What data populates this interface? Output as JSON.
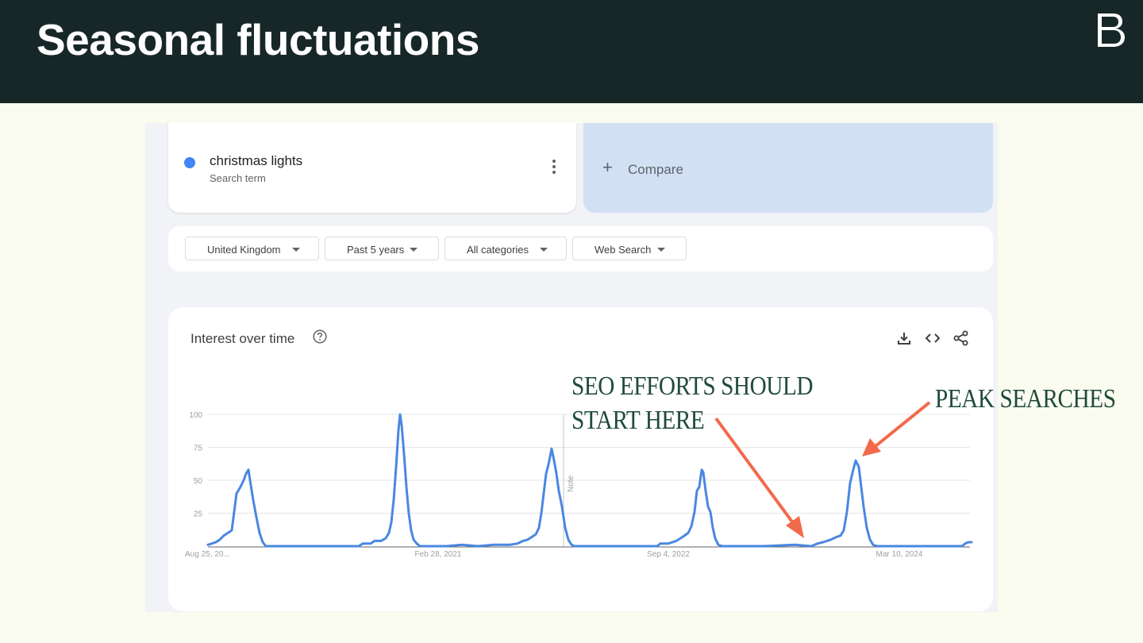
{
  "slide": {
    "title": "Seasonal fluctuations",
    "logo": "B"
  },
  "search_term": {
    "name": "christmas lights",
    "type": "Search term",
    "color": "#4285f4"
  },
  "compare": {
    "label": "Compare",
    "icon": "plus-icon"
  },
  "filters": [
    {
      "label": "United Kingdom"
    },
    {
      "label": "Past 5 years"
    },
    {
      "label": "All categories"
    },
    {
      "label": "Web Search"
    }
  ],
  "chart_card": {
    "title": "Interest over time",
    "icons": [
      "help-icon",
      "download-icon",
      "embed-icon",
      "share-icon"
    ]
  },
  "annotations": {
    "seo_line1": "SEO EFFORTS SHOULD",
    "seo_line2": "START HERE",
    "peak": "PEAK SEARCHES",
    "arrow_color": "#f26a4b"
  },
  "chart_data": {
    "type": "line",
    "title": "",
    "ylim": [
      0,
      100
    ],
    "y_ticks": [
      "25",
      "50",
      "75",
      "100"
    ],
    "x_tick_labels": [
      "Aug 25, 20...",
      "Feb 28, 2021",
      "Sep 4, 2022",
      "Mar 10, 2024"
    ],
    "note_label": "Note",
    "grid": true,
    "series": [
      {
        "name": "christmas lights",
        "color": "#4a87e0",
        "points": [
          [
            0,
            1
          ],
          [
            5,
            2
          ],
          [
            10,
            3
          ],
          [
            15,
            5
          ],
          [
            20,
            8
          ],
          [
            25,
            10
          ],
          [
            30,
            12
          ],
          [
            36,
            40
          ],
          [
            41,
            45
          ],
          [
            45,
            50
          ],
          [
            48,
            55
          ],
          [
            51,
            58
          ],
          [
            53,
            50
          ],
          [
            57,
            35
          ],
          [
            61,
            22
          ],
          [
            65,
            10
          ],
          [
            69,
            3
          ],
          [
            73,
            0
          ],
          [
            120,
            0
          ],
          [
            170,
            0
          ],
          [
            190,
            0
          ],
          [
            195,
            2
          ],
          [
            205,
            2
          ],
          [
            210,
            4
          ],
          [
            218,
            4
          ],
          [
            224,
            6
          ],
          [
            228,
            10
          ],
          [
            231,
            18
          ],
          [
            234,
            35
          ],
          [
            237,
            60
          ],
          [
            240,
            88
          ],
          [
            242,
            100
          ],
          [
            244,
            92
          ],
          [
            247,
            70
          ],
          [
            250,
            45
          ],
          [
            253,
            25
          ],
          [
            256,
            12
          ],
          [
            259,
            5
          ],
          [
            263,
            2
          ],
          [
            267,
            0
          ],
          [
            300,
            0
          ],
          [
            320,
            1
          ],
          [
            340,
            0
          ],
          [
            360,
            1
          ],
          [
            380,
            1
          ],
          [
            390,
            2
          ],
          [
            397,
            4
          ],
          [
            403,
            5
          ],
          [
            408,
            7
          ],
          [
            413,
            9
          ],
          [
            417,
            14
          ],
          [
            420,
            25
          ],
          [
            423,
            40
          ],
          [
            426,
            55
          ],
          [
            429,
            62
          ],
          [
            433,
            74
          ],
          [
            436,
            65
          ],
          [
            439,
            55
          ],
          [
            442,
            42
          ],
          [
            446,
            30
          ],
          [
            450,
            14
          ],
          [
            454,
            5
          ],
          [
            458,
            1
          ],
          [
            462,
            0
          ],
          [
            520,
            0
          ],
          [
            566,
            0
          ],
          [
            570,
            2
          ],
          [
            580,
            2
          ],
          [
            590,
            4
          ],
          [
            598,
            7
          ],
          [
            605,
            10
          ],
          [
            609,
            15
          ],
          [
            613,
            26
          ],
          [
            616,
            42
          ],
          [
            619,
            45
          ],
          [
            622,
            58
          ],
          [
            624,
            56
          ],
          [
            627,
            42
          ],
          [
            630,
            30
          ],
          [
            633,
            26
          ],
          [
            636,
            14
          ],
          [
            639,
            6
          ],
          [
            643,
            1
          ],
          [
            648,
            0
          ],
          [
            700,
            0
          ],
          [
            740,
            1
          ],
          [
            760,
            0
          ],
          [
            768,
            2
          ],
          [
            775,
            3
          ],
          [
            785,
            5
          ],
          [
            792,
            7
          ],
          [
            797,
            8
          ],
          [
            801,
            12
          ],
          [
            805,
            26
          ],
          [
            809,
            48
          ],
          [
            813,
            58
          ],
          [
            816,
            65
          ],
          [
            820,
            60
          ],
          [
            823,
            45
          ],
          [
            826,
            30
          ],
          [
            830,
            14
          ],
          [
            834,
            5
          ],
          [
            838,
            1
          ],
          [
            843,
            0
          ],
          [
            900,
            0
          ],
          [
            950,
            0
          ],
          [
            954,
            2
          ],
          [
            958,
            3
          ],
          [
            962,
            3
          ]
        ]
      }
    ]
  }
}
